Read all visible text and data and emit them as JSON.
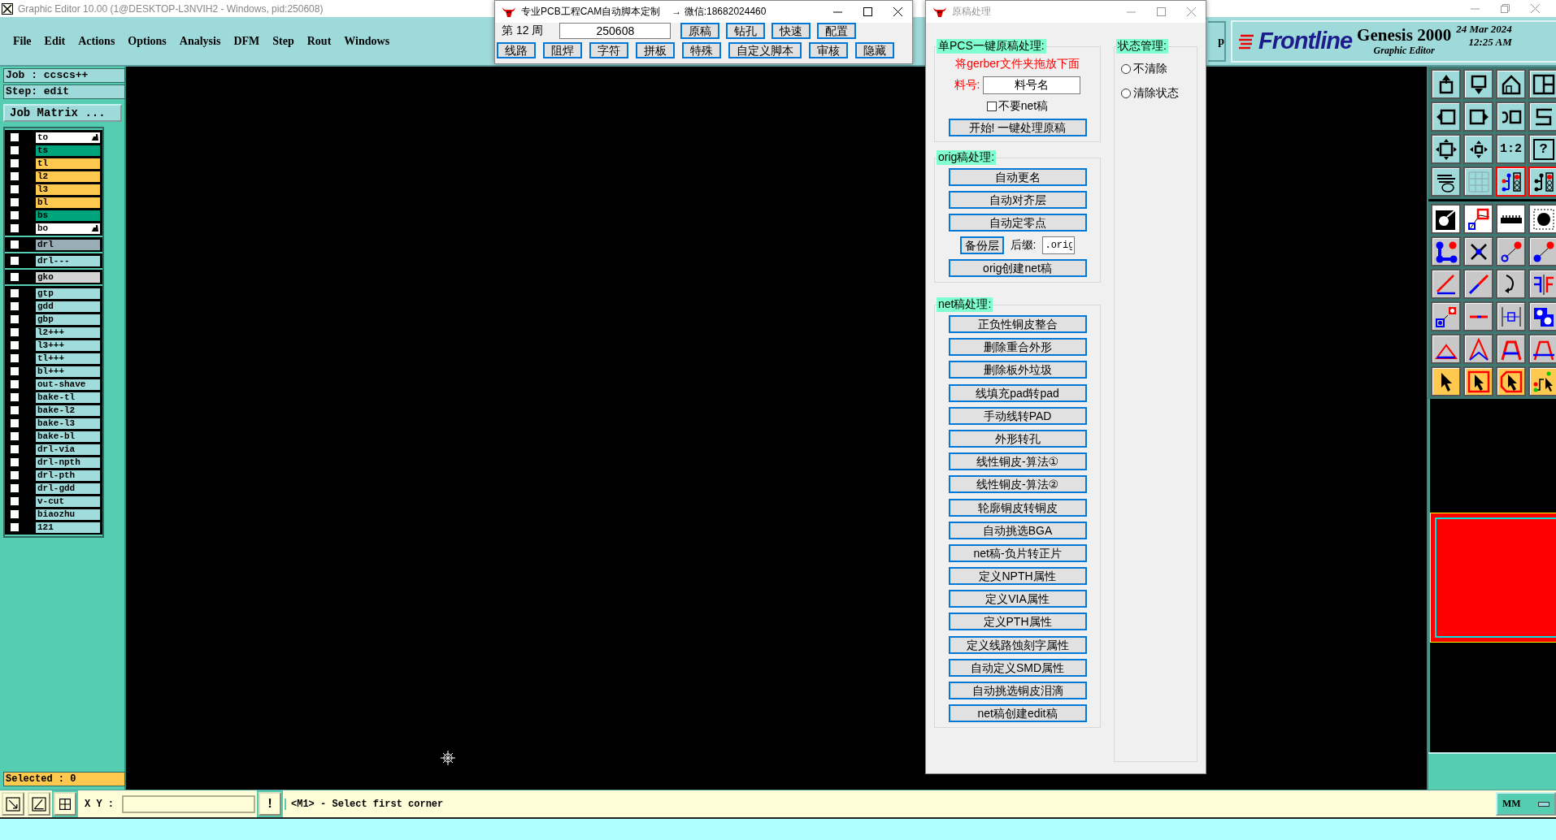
{
  "main_window": {
    "title": "Graphic Editor 10.00 (1@DESKTOP-L3NVIH2 - Windows, pid:250608)",
    "menu": [
      "File",
      "Edit",
      "Actions",
      "Options",
      "Analysis",
      "DFM",
      "Step",
      "Rout",
      "Windows"
    ],
    "cut_button": "p"
  },
  "branding": {
    "logo": "Frontline",
    "product": "Genesis 2000",
    "subtitle": "Graphic Editor",
    "date": "24 Mar 2024",
    "time": "12:25 AM"
  },
  "job_panel": {
    "job": "Job : ccscs++",
    "step": "Step: edit",
    "matrix_button": "Job Matrix ...",
    "selected": "Selected : 0",
    "layer_groups": [
      {
        "layers": [
          {
            "name": "to",
            "color": "#ffffff",
            "checked": false,
            "pointer": true
          },
          {
            "name": "ts",
            "color": "#00a47c",
            "checked": false,
            "pointer": false
          },
          {
            "name": "tl",
            "color": "#ffc84f",
            "checked": false,
            "pointer": false
          },
          {
            "name": "l2",
            "color": "#ffc84f",
            "checked": false,
            "pointer": false
          },
          {
            "name": "l3",
            "color": "#ffc84f",
            "checked": false,
            "pointer": false
          },
          {
            "name": "bl",
            "color": "#ffc84f",
            "checked": false,
            "pointer": false
          },
          {
            "name": "bs",
            "color": "#00a47c",
            "checked": false,
            "pointer": false
          },
          {
            "name": "bo",
            "color": "#ffffff",
            "checked": false,
            "pointer": true
          }
        ]
      },
      {
        "layers": [
          {
            "name": "drl",
            "color": "#98adb5",
            "checked": false,
            "pointer": false
          }
        ]
      },
      {
        "layers": [
          {
            "name": "drl---",
            "color": "#a0dcdc",
            "checked": false,
            "pointer": false
          }
        ]
      },
      {
        "layers": [
          {
            "name": "gko",
            "color": "#d4d4d4",
            "checked": false,
            "pointer": false
          }
        ]
      },
      {
        "layers": [
          {
            "name": "gtp",
            "color": "#a0dcdc",
            "checked": false,
            "pointer": false
          },
          {
            "name": "gdd",
            "color": "#a0dcdc",
            "checked": false,
            "pointer": false
          },
          {
            "name": "gbp",
            "color": "#a0dcdc",
            "checked": false,
            "pointer": false
          },
          {
            "name": "l2+++",
            "color": "#a0dcdc",
            "checked": false,
            "pointer": false
          },
          {
            "name": "l3+++",
            "color": "#a0dcdc",
            "checked": false,
            "pointer": false
          },
          {
            "name": "tl+++",
            "color": "#a0dcdc",
            "checked": false,
            "pointer": false
          },
          {
            "name": "bl+++",
            "color": "#a0dcdc",
            "checked": false,
            "pointer": false
          },
          {
            "name": "out-shave",
            "color": "#a0dcdc",
            "checked": false,
            "pointer": false
          },
          {
            "name": "bake-tl",
            "color": "#a0dcdc",
            "checked": false,
            "pointer": false
          },
          {
            "name": "bake-l2",
            "color": "#a0dcdc",
            "checked": false,
            "pointer": false
          },
          {
            "name": "bake-l3",
            "color": "#a0dcdc",
            "checked": false,
            "pointer": false
          },
          {
            "name": "bake-bl",
            "color": "#a0dcdc",
            "checked": false,
            "pointer": false
          },
          {
            "name": "drl-via",
            "color": "#a0dcdc",
            "checked": false,
            "pointer": false
          },
          {
            "name": "drl-npth",
            "color": "#a0dcdc",
            "checked": false,
            "pointer": false
          },
          {
            "name": "drl-pth",
            "color": "#a0dcdc",
            "checked": false,
            "pointer": false
          },
          {
            "name": "drl-gdd",
            "color": "#a0dcdc",
            "checked": false,
            "pointer": false
          },
          {
            "name": "v-cut",
            "color": "#a0dcdc",
            "checked": false,
            "pointer": false
          },
          {
            "name": "biaozhu",
            "color": "#a0dcdc",
            "checked": false,
            "pointer": false
          },
          {
            "name": "121",
            "color": "#a0dcdc",
            "checked": false,
            "pointer": false
          }
        ]
      }
    ]
  },
  "toolbar": {
    "ratio_button": "1:2",
    "help_button": "?"
  },
  "command_bar": {
    "xy_label": "X Y :",
    "alert_button": "!",
    "message": "<M1> - Select first corner",
    "units": "MM"
  },
  "script_window": {
    "title": "专业PCB工程CAM自动脚本定制",
    "contact": "→ 微信:18682024460",
    "week": "第 12 周",
    "code": "250608",
    "buttons_row1": [
      "原稿",
      "钻孔",
      "快速",
      "配置"
    ],
    "buttons_row2": [
      "线路",
      "阻焊",
      "字符",
      "拼板",
      "特殊",
      "自定义脚本",
      "审核",
      "隐藏"
    ]
  },
  "dialog": {
    "title": "原稿处理",
    "single_pcs": {
      "heading": "单PCS一键原稿处理:",
      "hint": "将gerber文件夹拖放下面",
      "part_label": "料号:",
      "part_value": "料号名",
      "no_net": {
        "label": "不要net稿",
        "checked": false
      },
      "start_button": "开始! 一键处理原稿"
    },
    "state": {
      "heading": "状态管理:",
      "options": [
        {
          "label": "不清除",
          "selected": false
        },
        {
          "label": "清除状态",
          "selected": false
        }
      ]
    },
    "orig": {
      "heading": "orig稿处理:",
      "buttons": [
        "自动更名",
        "自动对齐层",
        "自动定零点"
      ],
      "backup_button": "备份层",
      "suffix_label": "后缀:",
      "suffix_value": ".orig",
      "create_button": "orig创建net稿"
    },
    "net": {
      "heading": "net稿处理:",
      "buttons": [
        "正负性铜皮整合",
        "删除重合外形",
        "删除板外垃圾",
        "线填充pad转pad",
        "手动线转PAD",
        "外形转孔",
        "线性铜皮-算法①",
        "线性铜皮-算法②",
        "轮廓铜皮转铜皮",
        "自动挑选BGA",
        "net稿-负片转正片",
        "定义NPTH属性",
        "定义VIA属性",
        "定义PTH属性",
        "定义线路蚀刻字属性",
        "自动定义SMD属性",
        "自动挑选铜皮泪滴",
        "net稿创建edit稿"
      ]
    }
  }
}
